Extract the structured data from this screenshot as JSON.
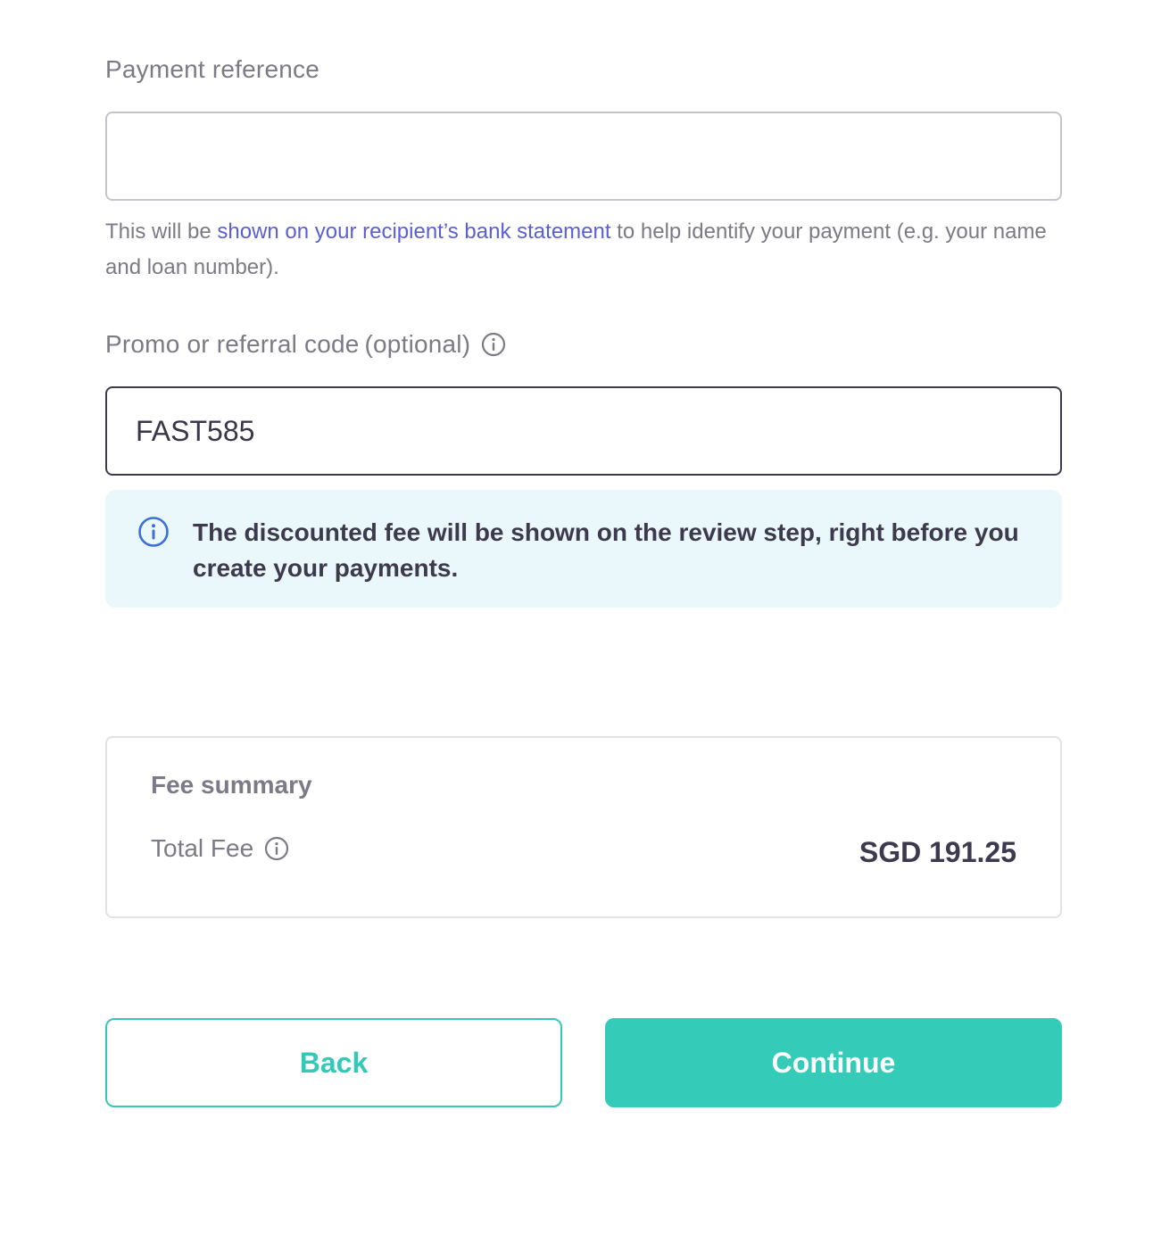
{
  "payment_reference": {
    "label": "Payment reference",
    "value": "",
    "placeholder": "",
    "helper_prefix": "This will be ",
    "helper_link": "shown on your recipient’s bank statement",
    "helper_suffix": " to help identify your payment (e.g. your name and loan number)."
  },
  "promo": {
    "label": "Promo or referral code",
    "optional_label": "(optional)",
    "value": "FAST585",
    "info_icon": "info-circle-icon"
  },
  "info_banner": {
    "icon": "info-circle-icon",
    "text": "The discounted fee will be shown on the review step, right before you create your payments."
  },
  "fee_summary": {
    "title": "Fee summary",
    "total_fee_label": "Total Fee",
    "total_fee_amount": "SGD 191.25"
  },
  "actions": {
    "back_label": "Back",
    "continue_label": "Continue"
  },
  "colors": {
    "accent": "#34cbb8",
    "link": "#5b5fd6",
    "info_icon": "#3d6fd9",
    "banner_bg": "#eaf7fb"
  }
}
